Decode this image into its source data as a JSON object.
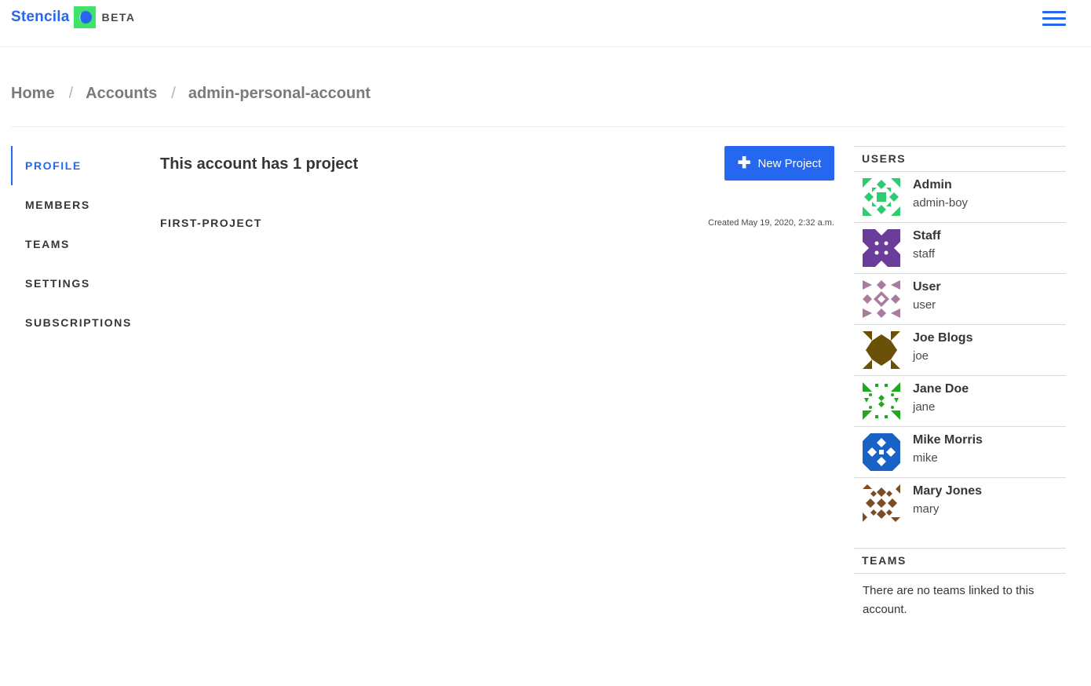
{
  "header": {
    "brand": "Stencila",
    "badge": "BETA",
    "colors": {
      "brand": "#2568ef",
      "logo_green": "#3fe36a",
      "logo_blue": "#2568ef"
    },
    "menu_icon": "hamburger-icon"
  },
  "breadcrumb": {
    "home": "Home",
    "sep": "/",
    "accounts": "Accounts",
    "current": "admin-personal-account"
  },
  "sidebar": {
    "items": [
      {
        "label": "PROFILE",
        "active": true
      },
      {
        "label": "MEMBERS",
        "active": false
      },
      {
        "label": "TEAMS",
        "active": false
      },
      {
        "label": "SETTINGS",
        "active": false
      },
      {
        "label": "SUBSCRIPTIONS",
        "active": false
      }
    ]
  },
  "main": {
    "count_prefix": "This account has",
    "count_value": "1",
    "count_suffix": "project",
    "new_project_label": "New Project",
    "new_project_icon": "plus-icon",
    "projects": [
      {
        "name": "FIRST-PROJECT",
        "created": "Created May 19, 2020, 2:32 a.m."
      }
    ]
  },
  "users_panel": {
    "heading": "USERS",
    "users": [
      {
        "name": "Admin",
        "username": "admin-boy",
        "avatar_color": "#2ecc71"
      },
      {
        "name": "Staff",
        "username": "staff",
        "avatar_color": "#6a3d9a"
      },
      {
        "name": "User",
        "username": "user",
        "avatar_color": "#a97b9f"
      },
      {
        "name": "Joe Blogs",
        "username": "joe",
        "avatar_color": "#6b5008"
      },
      {
        "name": "Jane Doe",
        "username": "jane",
        "avatar_color": "#22a81c"
      },
      {
        "name": "Mike Morris",
        "username": "mike",
        "avatar_color": "#1762c4"
      },
      {
        "name": "Mary Jones",
        "username": "mary",
        "avatar_color": "#7a4e22"
      }
    ]
  },
  "teams_panel": {
    "heading": "TEAMS",
    "empty_text": "There are no teams linked to this account."
  }
}
